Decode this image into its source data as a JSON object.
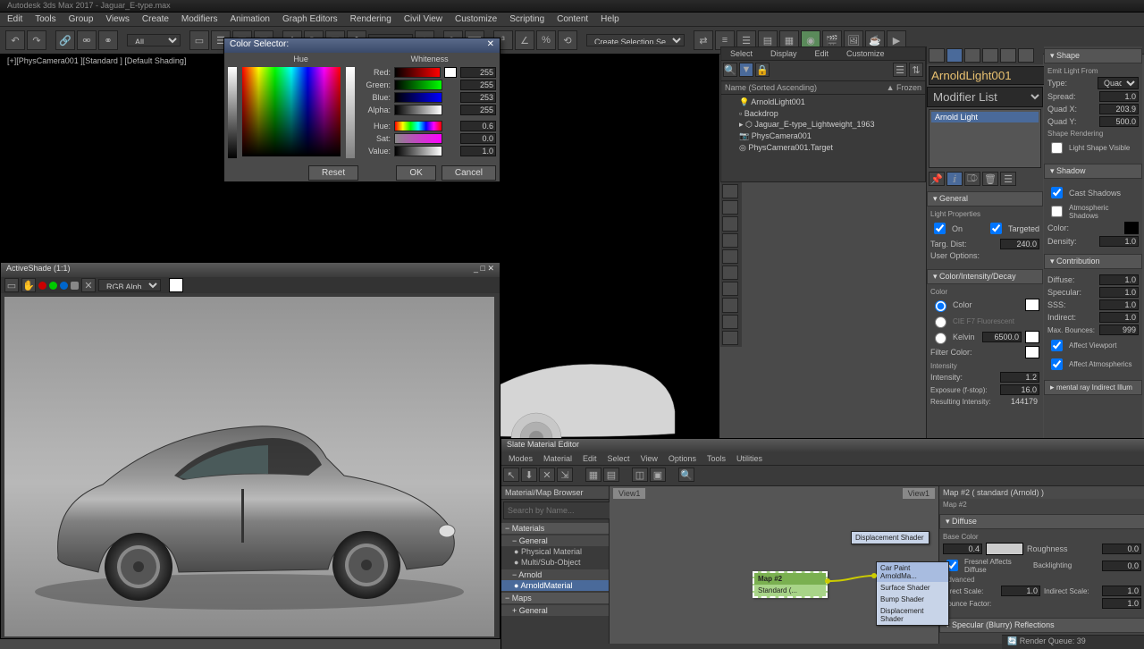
{
  "app": {
    "title": "Autodesk 3ds Max 2017 - Jaguar_E-type.max"
  },
  "menu": [
    "Edit",
    "Tools",
    "Group",
    "Views",
    "Create",
    "Modifiers",
    "Animation",
    "Graph Editors",
    "Rendering",
    "Civil View",
    "Customize",
    "Scripting",
    "Content",
    "Help"
  ],
  "vp_label": "[+][PhysCamera001 ][Standard ] [Default Shading]",
  "toolbar": {
    "sel_filter": "All",
    "selset": "Create Selection Se..."
  },
  "color_selector": {
    "title": "Color Selector:",
    "hue_lbl": "Hue",
    "whiteness_lbl": "Whiteness",
    "red": "Red:",
    "red_v": "255",
    "green": "Green:",
    "green_v": "255",
    "blue": "Blue:",
    "blue_v": "253",
    "alpha": "Alpha:",
    "alpha_v": "255",
    "hue2": "Hue:",
    "hue_v": "0.6",
    "sat": "Sat:",
    "sat_v": "0.0",
    "val": "Value:",
    "val_v": "1.0",
    "reset": "Reset",
    "ok": "OK",
    "cancel": "Cancel"
  },
  "activeshade": {
    "title": "ActiveShade  (1:1)",
    "channel": "RGB Alpha"
  },
  "scene": {
    "tabs": [
      "Select",
      "Display",
      "Edit",
      "Customize"
    ],
    "header": "Name (Sorted Ascending)",
    "frozen": "▲ Frozen",
    "nodes": [
      "ArnoldLight001",
      "Backdrop",
      "Jaguar_E-type_Lightweight_1963",
      "PhysCamera001",
      "PhysCamera001.Target"
    ]
  },
  "modify": {
    "objname": "ArnoldLight001",
    "modlist": "Modifier List",
    "stack_item": "Arnold Light",
    "general": "General",
    "light_props": "Light Properties",
    "on": "On",
    "targeted": "Targeted",
    "targ_dist": "Targ. Dist:",
    "targ_dist_v": "240.0",
    "user_opt": "User Options:",
    "cid": "Color/Intensity/Decay",
    "color_lbl": "Color",
    "color_mode": "Color",
    "preset": "CIE F7  Fluorescent",
    "kelvin": "Kelvin",
    "kelvin_v": "6500.0",
    "filter": "Filter Color:",
    "intensity_h": "Intensity",
    "intensity": "Intensity:",
    "intensity_v": "1.2",
    "exposure": "Exposure (f-stop):",
    "exposure_v": "16.0",
    "resulting": "Resulting Intensity:",
    "resulting_v": "144179"
  },
  "arnold": {
    "shape": "Shape",
    "emit": "Emit Light From",
    "type": "Type:",
    "type_v": "Quad",
    "spread": "Spread:",
    "spread_v": "1.0",
    "qx": "Quad X:",
    "qx_v": "203.9",
    "qy": "Quad Y:",
    "qy_v": "500.0",
    "shape_render": "Shape Rendering",
    "light_shape": "Light Shape Visible",
    "shadow": "Shadow",
    "cast": "Cast Shadows",
    "atmo": "Atmospheric Shadows",
    "color": "Color:",
    "density": "Density:",
    "density_v": "1.0",
    "contrib": "Contribution",
    "diffuse": "Diffuse:",
    "diffuse_v": "1.0",
    "specular": "Specular:",
    "specular_v": "1.0",
    "sss": "SSS:",
    "sss_v": "1.0",
    "indirect": "Indirect:",
    "indirect_v": "1.0",
    "maxb": "Max. Bounces:",
    "maxb_v": "999",
    "affvp": "Affect Viewport",
    "affatmo": "Affect Atmospherics",
    "mray": "mental ray Indirect Illum"
  },
  "slate": {
    "title": "Slate Material Editor",
    "menu": [
      "Modes",
      "Material",
      "Edit",
      "Select",
      "View",
      "Options",
      "Tools",
      "Utilities"
    ],
    "browser": "Material/Map Browser",
    "search": "Search by Name...",
    "materials": "Materials",
    "general": "General",
    "items": [
      "Physical Material",
      "Multi/Sub-Object"
    ],
    "arnold": "Arnold",
    "arnold_mat": "ArnoldMaterial",
    "maps": "Maps",
    "maps_general": "General",
    "view": "View1",
    "view_right": "View1",
    "node1": "Displacement Shader",
    "node2a": "Map #2",
    "node2b": "Standard (...",
    "node3_title": "Car Paint\nArnoldMa...",
    "node3_r1": "Surface Shader",
    "node3_r2": "Bump Shader",
    "node3_r3": "Displacement Shader",
    "param_title": "Map #2  ( standard (Arnold) )",
    "param_sub": "Map #2",
    "roll_diffuse": "Diffuse",
    "base_color": "Base Color",
    "base_v": "0.4",
    "rough": "Roughness",
    "rough_v": "0.0",
    "fresnel": "Fresnel Affects Diffuse",
    "backlight": "Backlighting",
    "backlight_v": "0.0",
    "advanced": "Advanced",
    "direct": "Direct Scale:",
    "direct_v": "1.0",
    "indirect_s": "Indirect Scale:",
    "indirect_sv": "1.0",
    "bounce": "Bounce Factor:",
    "bounce_v": "1.0",
    "spec_roll": "Specular (Blurry) Reflections"
  },
  "status": "Render Queue: 39"
}
